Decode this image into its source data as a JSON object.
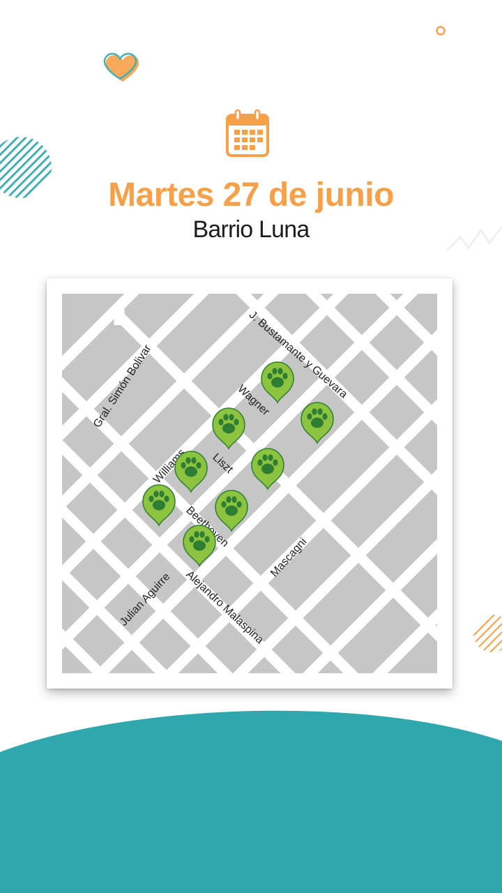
{
  "header": {
    "date": "Martes 27 de junio",
    "neighborhood": "Barrio Luna"
  },
  "icons": {
    "calendar": "calendar-icon",
    "heart": "heart-icon",
    "pin": "paw-pin-icon"
  },
  "colors": {
    "orange": "#f7a04a",
    "teal": "#2fa8ad",
    "map_bg": "#c6c6c7",
    "pin_green": "#8cc43f",
    "pin_dark": "#2e7d32"
  },
  "map": {
    "streets": [
      "J. Bustamante y Guevara",
      "Gral. Simón Bolivar",
      "Wagner",
      "Williams",
      "Liszt",
      "Beethoven",
      "Mascagni",
      "Julian Aguirre",
      "Alejandro Malaspina"
    ]
  }
}
